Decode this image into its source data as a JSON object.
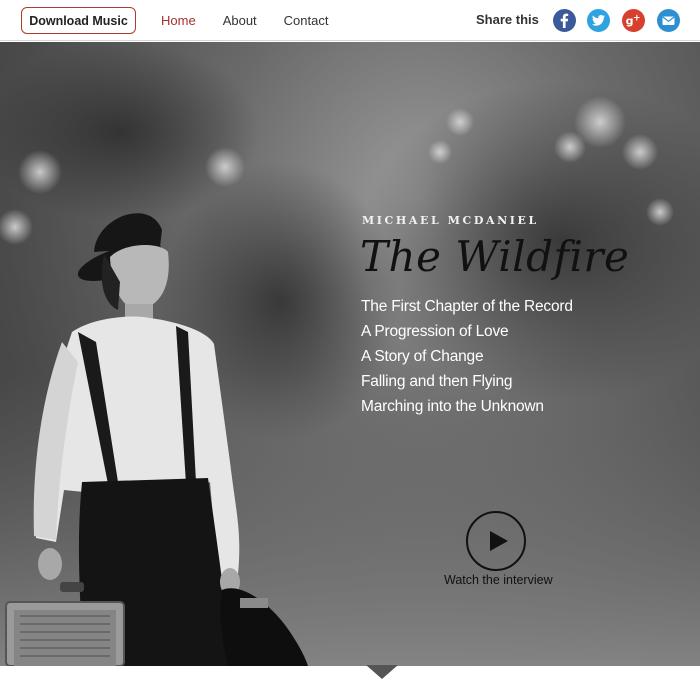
{
  "header": {
    "download_label": "Download Music",
    "nav": [
      {
        "label": "Home",
        "active": true
      },
      {
        "label": "About",
        "active": false
      },
      {
        "label": "Contact",
        "active": false
      }
    ],
    "share_label": "Share this",
    "social_icons": [
      "facebook-icon",
      "twitter-icon",
      "google-plus-icon",
      "email-icon"
    ]
  },
  "hero": {
    "artist": "MICHAEL MCDANIEL",
    "album_title": "The Wildfire",
    "taglines": [
      "The First Chapter of the Record",
      "A Progression of Love",
      "A Story of Change",
      "Falling and then Flying",
      "Marching into the Unknown"
    ],
    "video_label": "Watch the interview",
    "play_icon": "play-icon"
  },
  "colors": {
    "accent": "#a3312a",
    "facebook": "#3b5a9a",
    "twitter": "#2ea3e0",
    "google_plus": "#d7402e",
    "email": "#2d8fd2"
  }
}
